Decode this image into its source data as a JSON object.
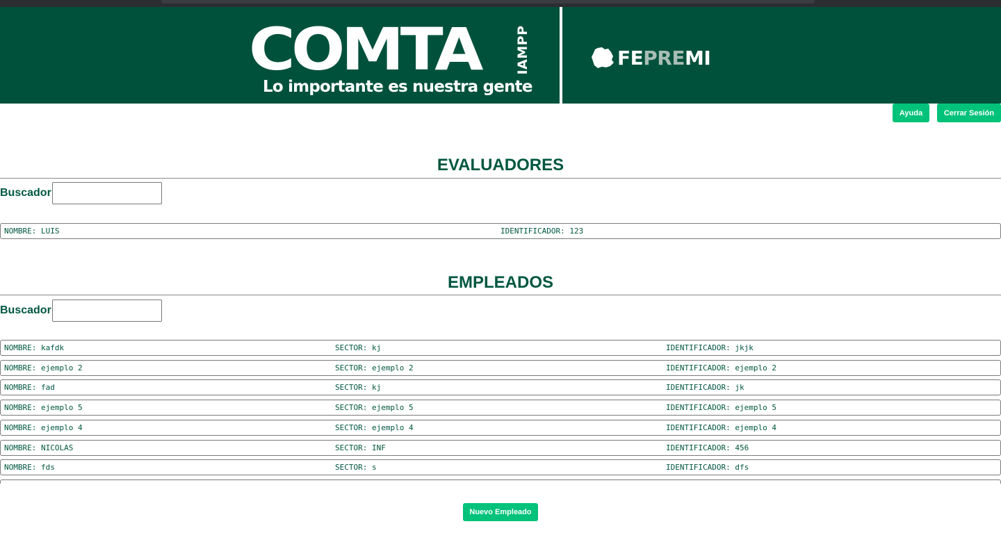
{
  "header": {
    "brand": "COMTA",
    "brand_suffix": "IAMPP",
    "tagline": "Lo importante es nuestra gente",
    "partner_part1": "FE",
    "partner_part2": "PRE",
    "partner_part3": "MI",
    "brand_color": "#00513b",
    "accent_color": "#00c27a"
  },
  "toolbar": {
    "help_label": "Ayuda",
    "logout_label": "Cerrar Sesión"
  },
  "evaluadores": {
    "title": "EVALUADORES",
    "search_label": "Buscador:",
    "search_value": "",
    "rows": [
      {
        "nombre": "NOMBRE: LUIS",
        "identificador": "IDENTIFICADOR: 123"
      }
    ]
  },
  "empleados": {
    "title": "EMPLEADOS",
    "search_label": "Buscador:",
    "search_value": "",
    "rows": [
      {
        "nombre": "NOMBRE: kafdk",
        "sector": "SECTOR: kj",
        "identificador": "IDENTIFICADOR: jkjk"
      },
      {
        "nombre": "NOMBRE: ejemplo 2",
        "sector": "SECTOR: ejemplo 2",
        "identificador": "IDENTIFICADOR: ejemplo 2"
      },
      {
        "nombre": "NOMBRE: fad",
        "sector": "SECTOR: kj",
        "identificador": "IDENTIFICADOR: jk"
      },
      {
        "nombre": "NOMBRE: ejemplo 5",
        "sector": "SECTOR: ejemplo 5",
        "identificador": "IDENTIFICADOR: ejemplo 5"
      },
      {
        "nombre": "NOMBRE: ejemplo 4",
        "sector": "SECTOR: ejemplo 4",
        "identificador": "IDENTIFICADOR: ejemplo 4"
      },
      {
        "nombre": "NOMBRE: NICOLAS",
        "sector": "SECTOR: INF",
        "identificador": "IDENTIFICADOR: 456"
      },
      {
        "nombre": "NOMBRE: fds",
        "sector": "SECTOR: s",
        "identificador": "IDENTIFICADOR: dfs"
      }
    ],
    "new_button_label": "Nuevo Empleado"
  }
}
